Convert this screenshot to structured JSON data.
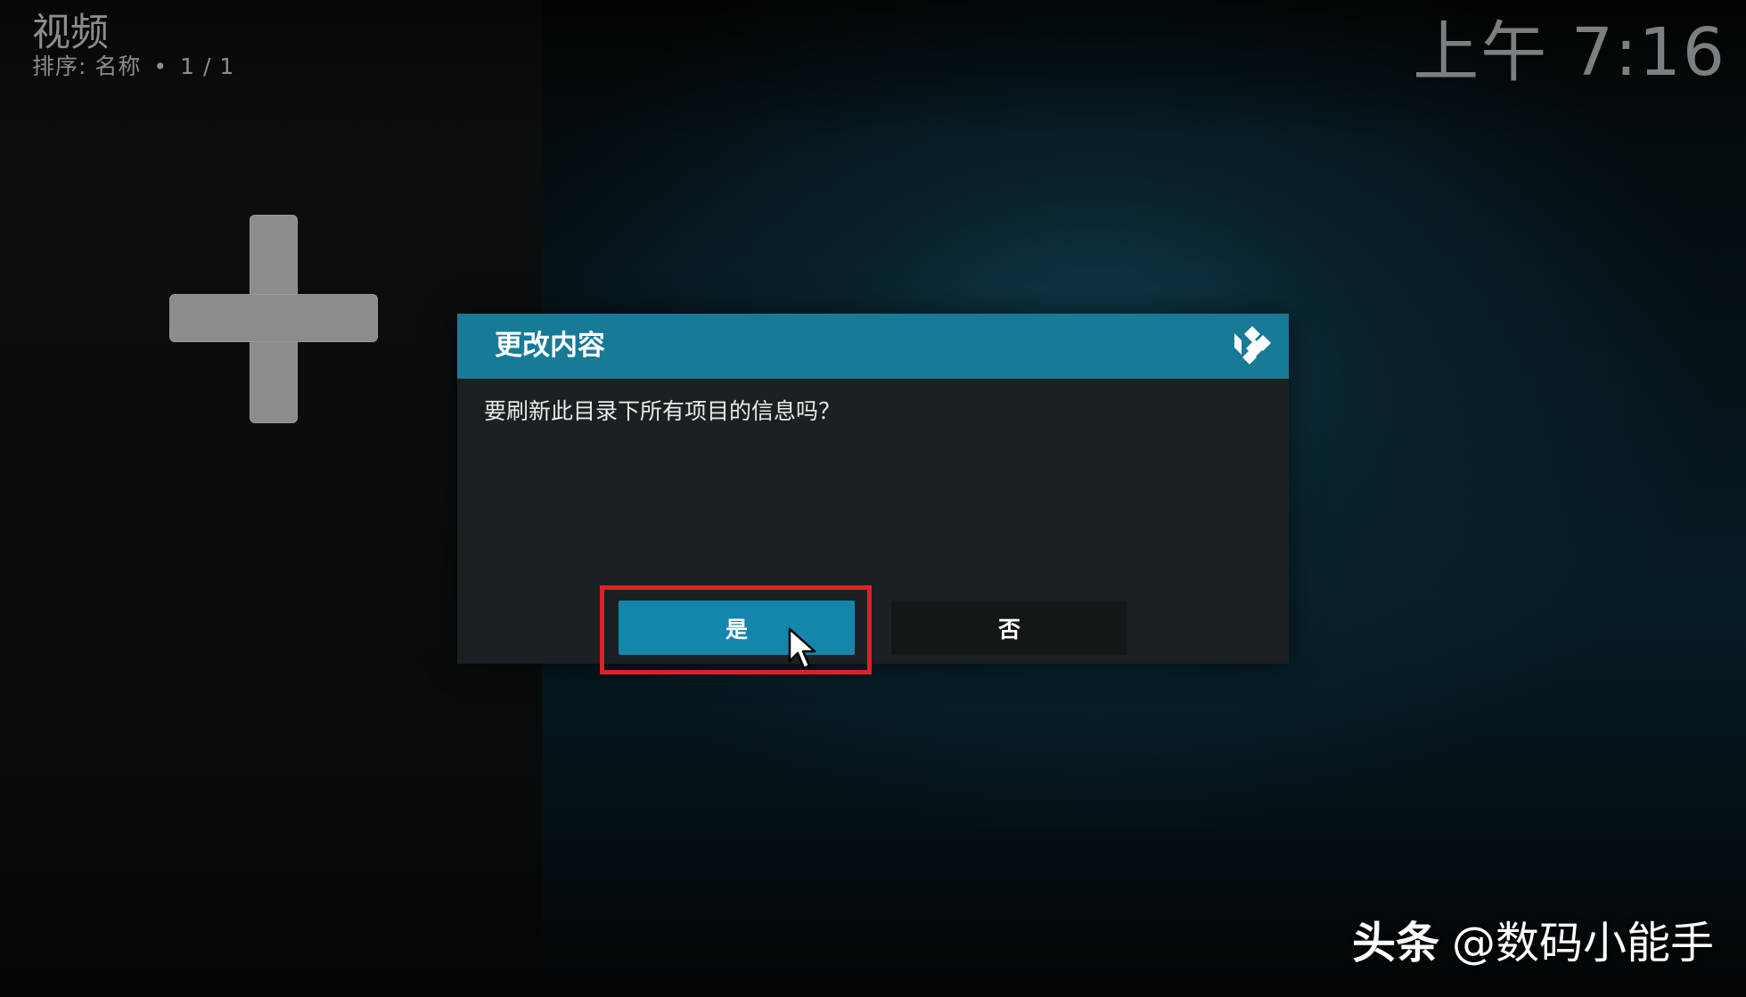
{
  "header": {
    "title": "视频",
    "sort_label": "排序: 名称",
    "separator": "•",
    "page_count": "1 / 1"
  },
  "clock": {
    "time": "上午 7:16"
  },
  "add_tile": {
    "icon": "plus-icon"
  },
  "dialog": {
    "title": "更改内容",
    "logo_icon": "kodi-logo-icon",
    "message": "要刷新此目录下所有项目的信息吗？",
    "yes_label": "是",
    "no_label": "否",
    "accent_color": "#177a97",
    "focused_button_color": "#1486ab"
  },
  "annotation": {
    "highlight_color": "#e0202a"
  },
  "watermark": {
    "brand": "头条",
    "handle": "@数码小能手"
  }
}
